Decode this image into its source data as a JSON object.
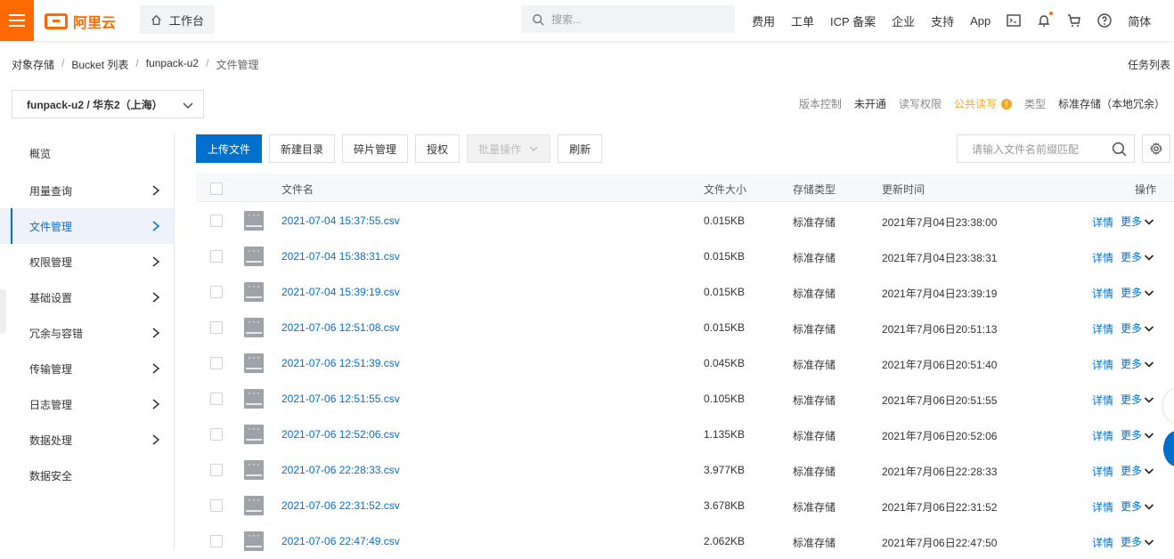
{
  "header": {
    "logo_text": "阿里云",
    "workbench_label": "工作台",
    "search_placeholder": "搜索...",
    "nav": [
      "费用",
      "工单",
      "ICP 备案",
      "企业",
      "支持",
      "App"
    ],
    "lang": "简体",
    "accent_color": "#ff6a00"
  },
  "breadcrumb": {
    "items": [
      "对象存储",
      "Bucket 列表",
      "funpack-u2",
      "文件管理"
    ],
    "separator": "/",
    "task_list": "任务列表"
  },
  "bucket": {
    "selector_label": "funpack-u2 / 华东2（上海）"
  },
  "meta": {
    "version_label": "版本控制",
    "version_value": "未开通",
    "acl_label": "读写权限",
    "acl_value": "公共读写",
    "type_label": "类型",
    "type_value": "标准存储（本地冗余）"
  },
  "sidebar": {
    "items": [
      {
        "label": "概览",
        "arrow": false
      },
      {
        "label": "用量查询",
        "arrow": true
      },
      {
        "label": "文件管理",
        "arrow": true,
        "active": true
      },
      {
        "label": "权限管理",
        "arrow": true
      },
      {
        "label": "基础设置",
        "arrow": true
      },
      {
        "label": "冗余与容错",
        "arrow": true
      },
      {
        "label": "传输管理",
        "arrow": true
      },
      {
        "label": "日志管理",
        "arrow": true
      },
      {
        "label": "数据处理",
        "arrow": true
      },
      {
        "label": "数据安全",
        "arrow": false
      }
    ]
  },
  "toolbar": {
    "upload": "上传文件",
    "new_dir": "新建目录",
    "fragments": "碎片管理",
    "authorize": "授权",
    "batch": "批量操作",
    "refresh": "刷新",
    "search_placeholder": "请输入文件名前缀匹配"
  },
  "table": {
    "headers": {
      "name": "文件名",
      "size": "文件大小",
      "storage": "存储类型",
      "updated": "更新时间",
      "actions": "操作"
    },
    "detail_label": "详情",
    "more_label": "更多",
    "rows": [
      {
        "name": "2021-07-04 15:37:55.csv",
        "size": "0.015KB",
        "storage": "标准存储",
        "updated": "2021年7月04日23:38:00"
      },
      {
        "name": "2021-07-04 15:38:31.csv",
        "size": "0.015KB",
        "storage": "标准存储",
        "updated": "2021年7月04日23:38:31"
      },
      {
        "name": "2021-07-04 15:39:19.csv",
        "size": "0.015KB",
        "storage": "标准存储",
        "updated": "2021年7月04日23:39:19"
      },
      {
        "name": "2021-07-06 12:51:08.csv",
        "size": "0.015KB",
        "storage": "标准存储",
        "updated": "2021年7月06日20:51:13"
      },
      {
        "name": "2021-07-06 12:51:39.csv",
        "size": "0.045KB",
        "storage": "标准存储",
        "updated": "2021年7月06日20:51:40"
      },
      {
        "name": "2021-07-06 12:51:55.csv",
        "size": "0.105KB",
        "storage": "标准存储",
        "updated": "2021年7月06日20:51:55"
      },
      {
        "name": "2021-07-06 12:52:06.csv",
        "size": "1.135KB",
        "storage": "标准存储",
        "updated": "2021年7月06日20:52:06"
      },
      {
        "name": "2021-07-06 22:28:33.csv",
        "size": "3.977KB",
        "storage": "标准存储",
        "updated": "2021年7月06日22:28:33"
      },
      {
        "name": "2021-07-06 22:31:52.csv",
        "size": "3.678KB",
        "storage": "标准存储",
        "updated": "2021年7月06日22:31:52"
      },
      {
        "name": "2021-07-06 22:47:49.csv",
        "size": "2.062KB",
        "storage": "标准存储",
        "updated": "2021年7月06日22:47:50"
      }
    ]
  }
}
